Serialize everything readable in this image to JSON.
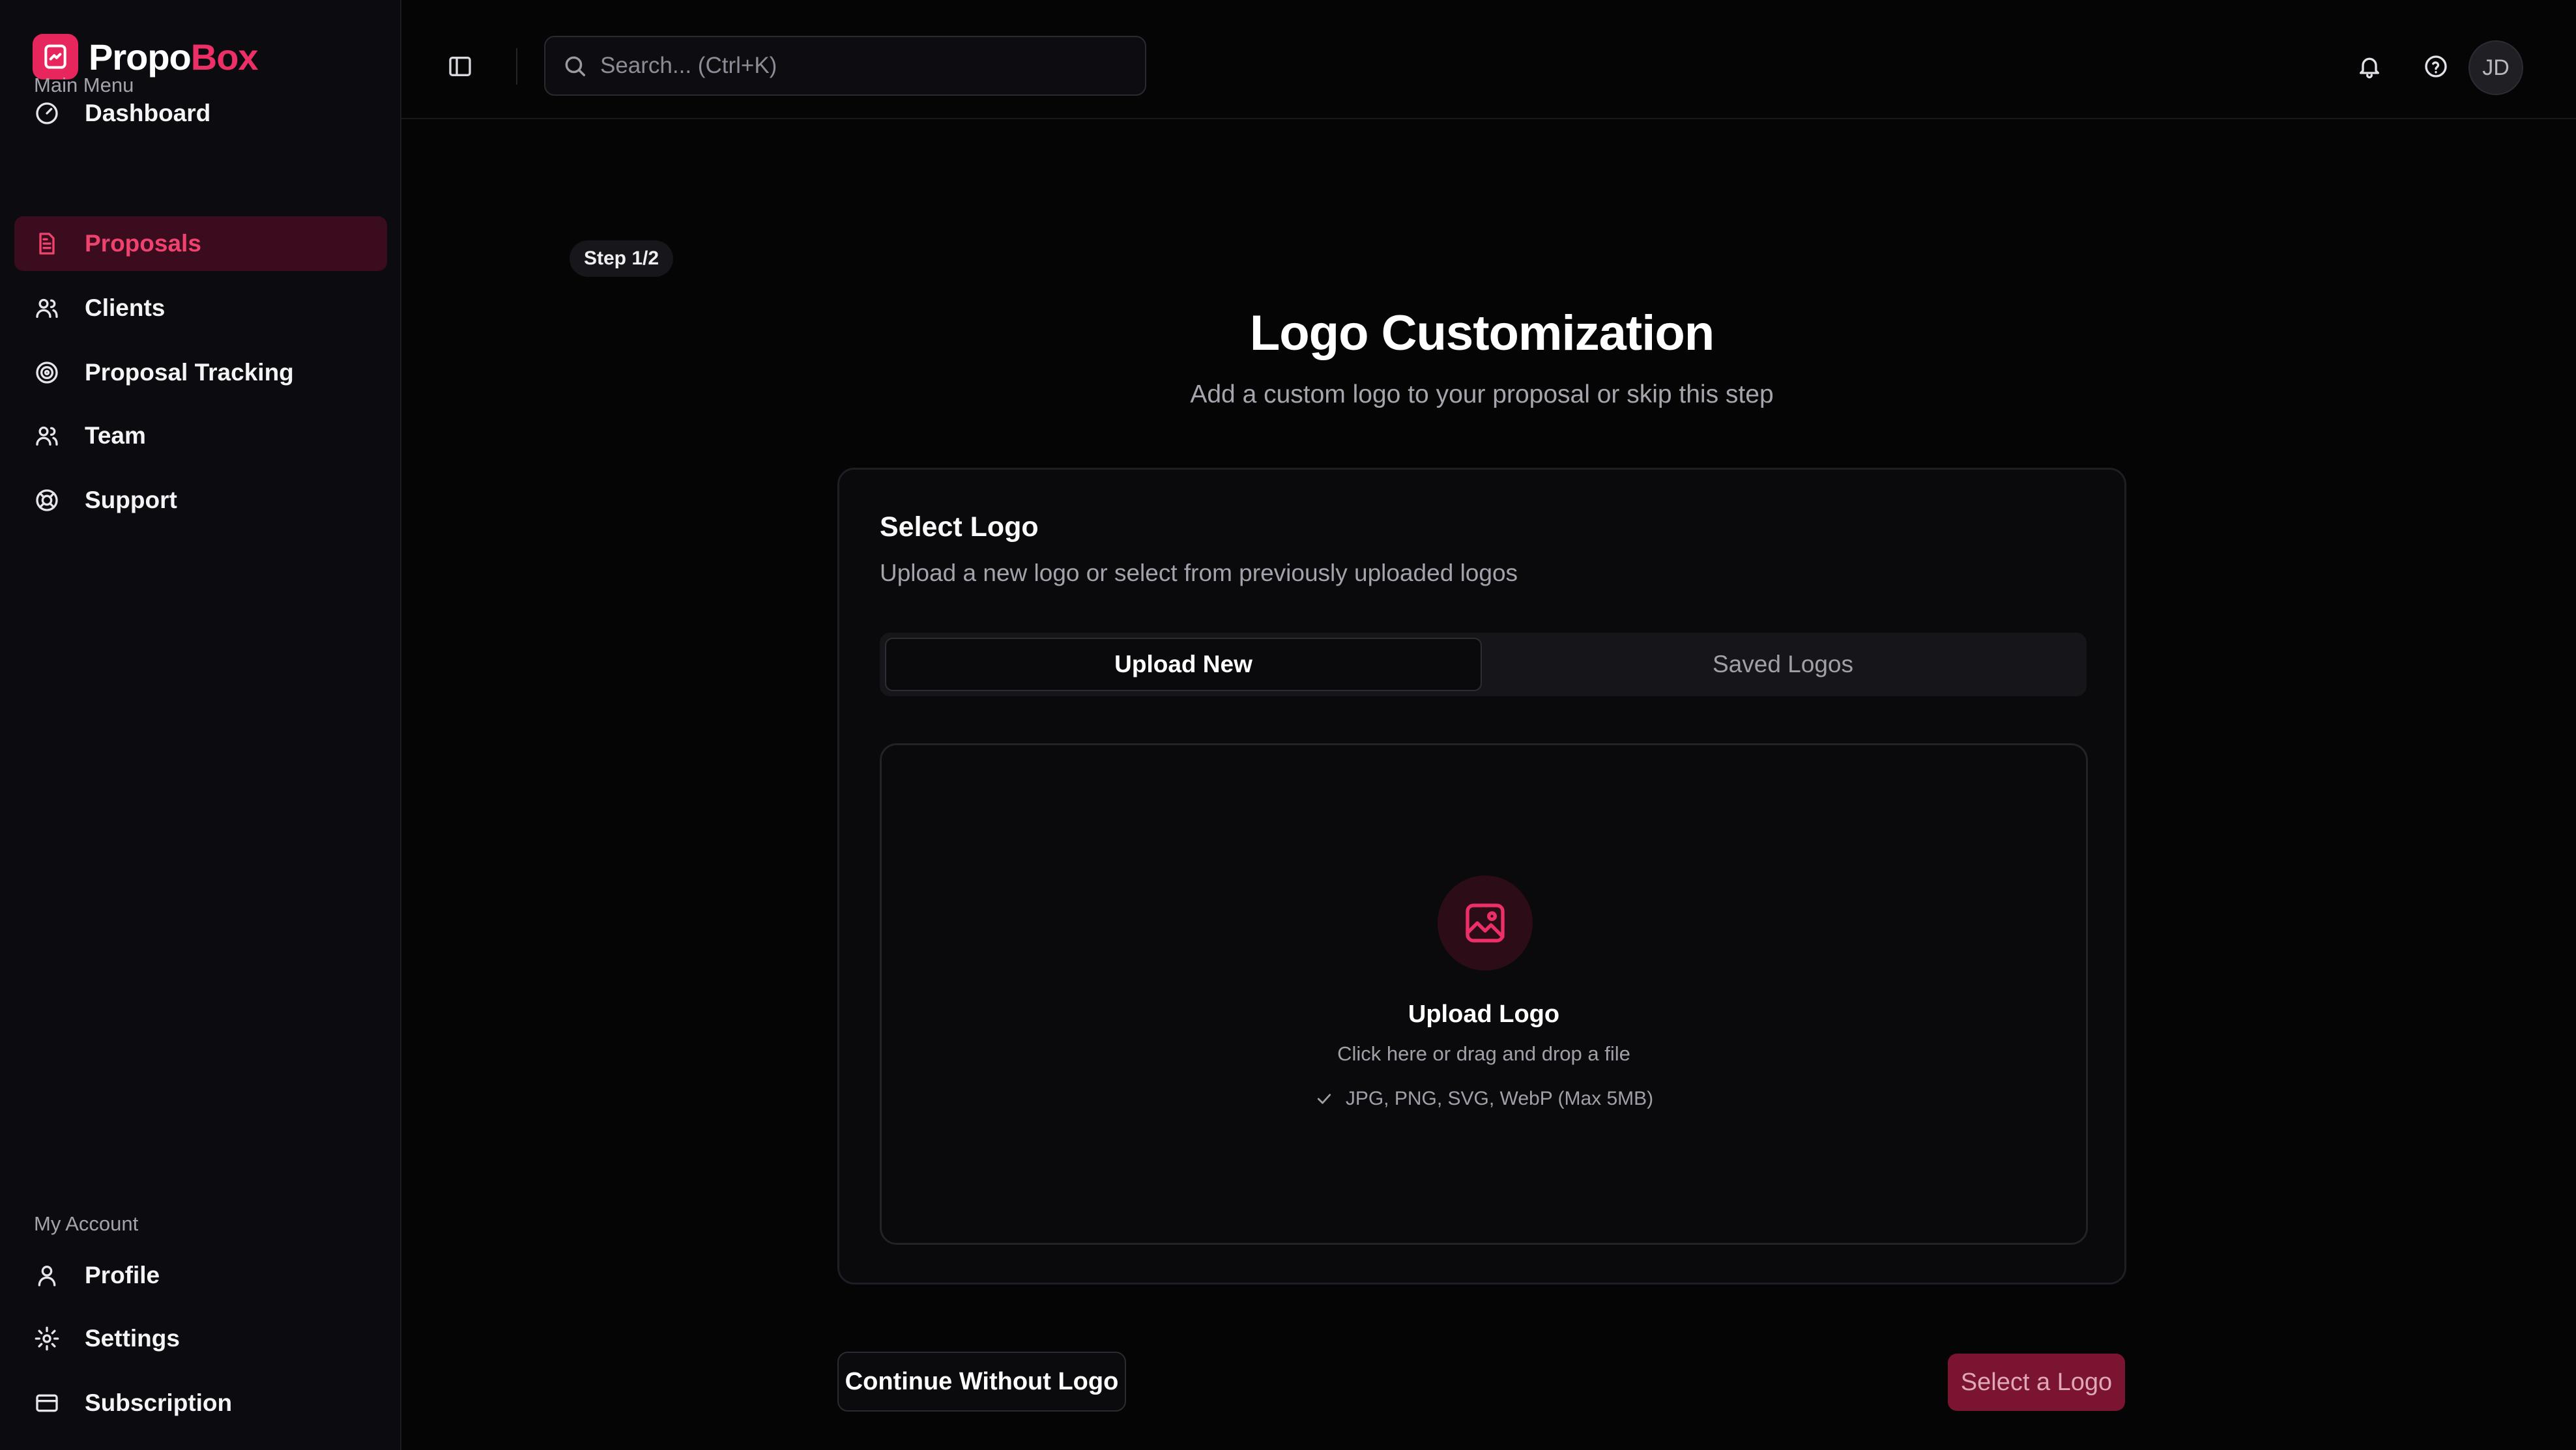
{
  "brand": {
    "name_part1": "Propo",
    "name_part2": "Box",
    "accent": "#e8265e"
  },
  "sidebar": {
    "main_menu_label": "Main Menu",
    "items": [
      {
        "label": "Dashboard",
        "icon": "gauge-icon",
        "active": false
      },
      {
        "label": "Proposals",
        "icon": "document-icon",
        "active": true
      },
      {
        "label": "Clients",
        "icon": "users-icon",
        "active": false
      },
      {
        "label": "Proposal Tracking",
        "icon": "radar-icon",
        "active": false
      },
      {
        "label": "Team",
        "icon": "team-icon",
        "active": false
      },
      {
        "label": "Support",
        "icon": "lifebuoy-icon",
        "active": false
      }
    ],
    "account_label": "My Account",
    "account_items": [
      {
        "label": "Profile",
        "icon": "user-icon"
      },
      {
        "label": "Settings",
        "icon": "gear-icon"
      },
      {
        "label": "Subscription",
        "icon": "credit-card-icon"
      }
    ]
  },
  "topbar": {
    "search_placeholder": "Search... (Ctrl+K)",
    "avatar_initials": "JD"
  },
  "page": {
    "step": "Step 1/2",
    "title": "Logo Customization",
    "subtitle": "Add a custom logo to your proposal or skip this step"
  },
  "card": {
    "title": "Select Logo",
    "subtitle": "Upload a new logo or select from previously uploaded logos",
    "tabs": [
      {
        "label": "Upload New",
        "active": true
      },
      {
        "label": "Saved Logos",
        "active": false
      }
    ],
    "dropzone": {
      "title": "Upload Logo",
      "hint": "Click here or drag and drop a file",
      "formats": "JPG, PNG, SVG, WebP (Max 5MB)"
    }
  },
  "actions": {
    "continue_label": "Continue Without Logo",
    "select_label": "Select a Logo"
  },
  "colors": {
    "background": "#050505",
    "sidebar": "#0c0c10",
    "accent": "#ec2f66",
    "active_nav_bg": "#3a0c1d",
    "disabled_primary": "#7a1430"
  }
}
